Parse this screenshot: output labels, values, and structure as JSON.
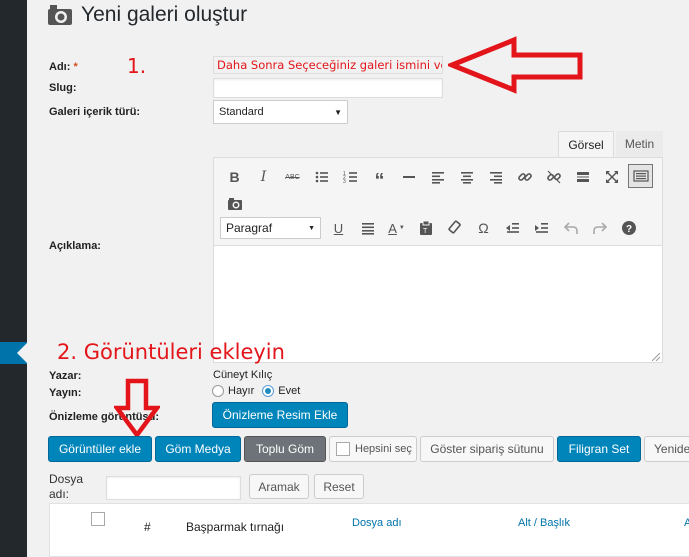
{
  "page": {
    "title": "Yeni galeri oluştur"
  },
  "form": {
    "name_label": "Adı:",
    "required_mark": "*",
    "name_value": "Daha Sonra Seçeceğiniz galeri ismini verin",
    "slug_label": "Slug:",
    "slug_value": "",
    "content_type_label": "Galeri içerik türü:",
    "content_type_value": "Standard",
    "description_label": "Açıklama:",
    "author_label": "Yazar:",
    "author_value": "Cüneyt Kılıç",
    "publish_label": "Yayın:",
    "publish_options": [
      "Hayır",
      "Evet"
    ],
    "publish_selected": "Evet",
    "preview_label": "Önizleme görüntüsü:",
    "preview_button": "Önizleme Resim Ekle"
  },
  "editor": {
    "tabs": [
      "Görsel",
      "Metin"
    ],
    "active_tab": "Görsel",
    "format_value": "Paragraf",
    "toolbar_row1": [
      "bold-icon",
      "italic-icon",
      "strikethrough-icon",
      "bullet-list-icon",
      "numbered-list-icon",
      "blockquote-icon",
      "horizontal-rule-icon",
      "align-left-icon",
      "align-center-icon",
      "align-right-icon",
      "link-icon",
      "unlink-icon",
      "read-more-icon",
      "fullscreen-icon",
      "toolbar-toggle-icon"
    ],
    "toolbar_row1b": [
      "camera-icon"
    ],
    "toolbar_row2": [
      "underline-icon",
      "justify-icon",
      "text-color-icon",
      "paste-text-icon",
      "clear-formatting-icon",
      "special-char-icon",
      "outdent-icon",
      "indent-icon",
      "undo-icon",
      "redo-icon",
      "help-icon"
    ]
  },
  "annotations": {
    "step1": "1.",
    "step2": "2. Görüntüleri ekleyin",
    "color": "#e3151a"
  },
  "actions": {
    "add_images": "Görüntüler ekle",
    "embed_media": "Göm Medya",
    "bulk_embed": "Toplu Göm",
    "select_all": "Hepsini seç",
    "show_order": "Göster sipariş sütunu",
    "watermark": "Filigran Set",
    "more": "Yenide"
  },
  "filter": {
    "file_label": "Dosya adı:",
    "search_button": "Aramak",
    "reset_button": "Reset"
  },
  "table": {
    "columns": [
      "#",
      "Başparmak tırnağı",
      "Dosya adı",
      "Alt / Başlık",
      "A"
    ]
  },
  "colors": {
    "primary": "#0085ba",
    "sidebar": "#23282d",
    "annotation": "#e3151a"
  }
}
